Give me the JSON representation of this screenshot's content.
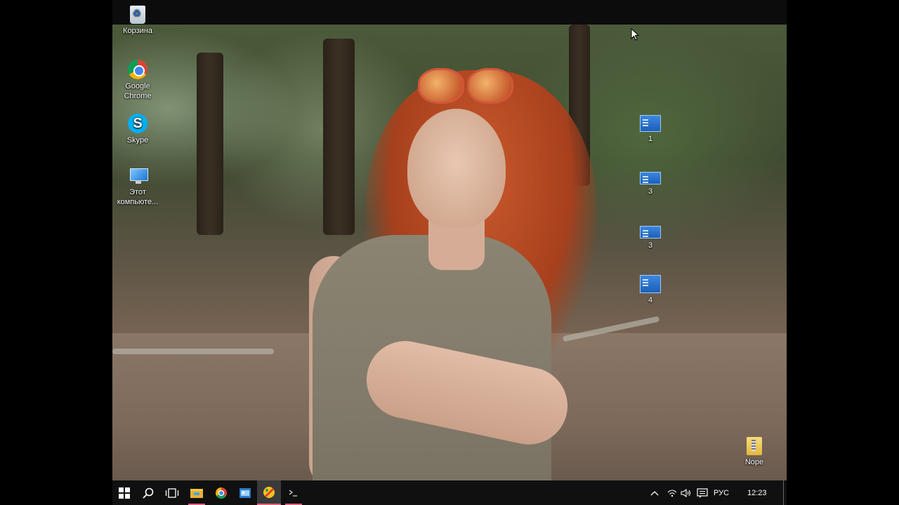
{
  "desktop": {
    "icons_left": [
      {
        "label": "Корзина",
        "icon": "recycle-bin-icon"
      },
      {
        "label": "Google Chrome",
        "icon": "chrome-icon"
      },
      {
        "label": "Skype",
        "icon": "skype-icon"
      },
      {
        "label": "Этот компьюте...",
        "icon": "this-pc-icon"
      }
    ],
    "icons_right": [
      {
        "label": "1",
        "icon": "window-file-icon"
      },
      {
        "label": "3",
        "icon": "window-file-icon"
      },
      {
        "label": "3",
        "icon": "window-file-icon"
      },
      {
        "label": "4",
        "icon": "window-file-icon"
      },
      {
        "label": "Nope",
        "icon": "zip-folder-icon"
      }
    ]
  },
  "taskbar": {
    "buttons": [
      "start-icon",
      "search-icon",
      "task-view-icon",
      "file-explorer-icon",
      "chrome-icon",
      "app-icon",
      "paint-icon",
      "terminal-icon"
    ],
    "tray": {
      "language": "РУС",
      "time": "12:23"
    }
  },
  "colors": {
    "taskbar_bg": "#101010",
    "accent": "#e0607e"
  }
}
